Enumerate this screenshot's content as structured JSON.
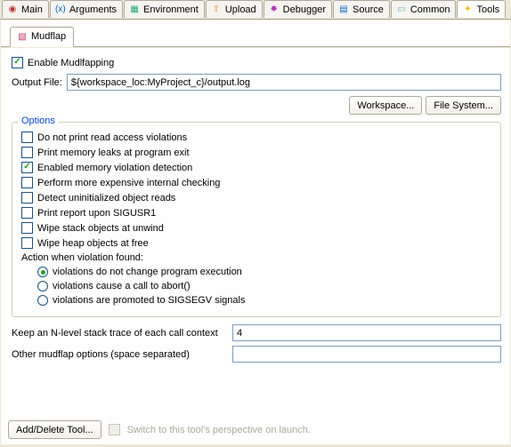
{
  "tabs": {
    "main": "Main",
    "arguments": "Arguments",
    "environment": "Environment",
    "upload": "Upload",
    "debugger": "Debugger",
    "source": "Source",
    "common": "Common",
    "tools": "Tools"
  },
  "subtab": "Mudflap",
  "enable": {
    "label": "Enable Mudlfapping",
    "checked": true
  },
  "outputFile": {
    "label": "Output File:",
    "value": "${workspace_loc:MyProject_c}/output.log"
  },
  "buttons": {
    "workspace": "Workspace...",
    "filesystem": "File System..."
  },
  "optionsTitle": "Options",
  "options": {
    "noRead": {
      "label": "Do not print read access violations",
      "checked": false
    },
    "memLeaks": {
      "label": "Print memory leaks at program exit",
      "checked": false
    },
    "violDet": {
      "label": "Enabled memory violation detection",
      "checked": true
    },
    "expensive": {
      "label": "Perform more expensive internal checking",
      "checked": false
    },
    "uninit": {
      "label": "Detect uninitialized object reads",
      "checked": false
    },
    "sigusr": {
      "label": "Print report upon SIGUSR1",
      "checked": false
    },
    "wipeStack": {
      "label": "Wipe stack objects at unwind",
      "checked": false
    },
    "wipeHeap": {
      "label": "Wipe heap objects at free",
      "checked": false
    }
  },
  "actionLabel": "Action when violation found:",
  "radios": {
    "noChange": "violations do not change program execution",
    "abort": "violations cause a call to abort()",
    "sigsegv": "violations are promoted to SIGSEGV signals"
  },
  "stackTrace": {
    "label": "Keep an N-level stack trace of each call context",
    "value": "4"
  },
  "otherOpts": {
    "label": "Other mudflap options (space separated)",
    "value": ""
  },
  "bottom": {
    "addDelete": "Add/Delete Tool...",
    "switchLabel": "Switch to this tool's perspective on launch."
  }
}
